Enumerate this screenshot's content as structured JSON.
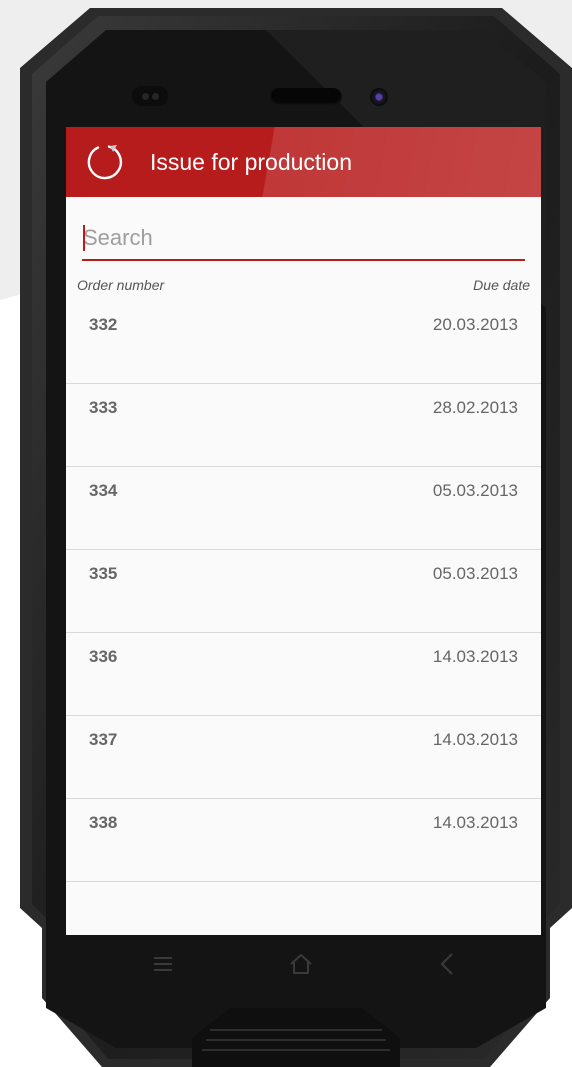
{
  "app": {
    "title": "Issue for production"
  },
  "search": {
    "placeholder": "Search",
    "value": ""
  },
  "columns": {
    "order_number": "Order number",
    "due_date": "Due date"
  },
  "orders": [
    {
      "number": "332",
      "due": "20.03.2013"
    },
    {
      "number": "333",
      "due": "28.02.2013"
    },
    {
      "number": "334",
      "due": "05.03.2013"
    },
    {
      "number": "335",
      "due": "05.03.2013"
    },
    {
      "number": "336",
      "due": "14.03.2013"
    },
    {
      "number": "337",
      "due": "14.03.2013"
    },
    {
      "number": "338",
      "due": "14.03.2013"
    }
  ],
  "navigation": {
    "icons": [
      "menu-icon",
      "home-icon",
      "back-icon"
    ]
  },
  "colors": {
    "accent": "#b71c1c",
    "background": "#fafafa",
    "text": "#666666",
    "phone_body": "#1a1a1a"
  }
}
